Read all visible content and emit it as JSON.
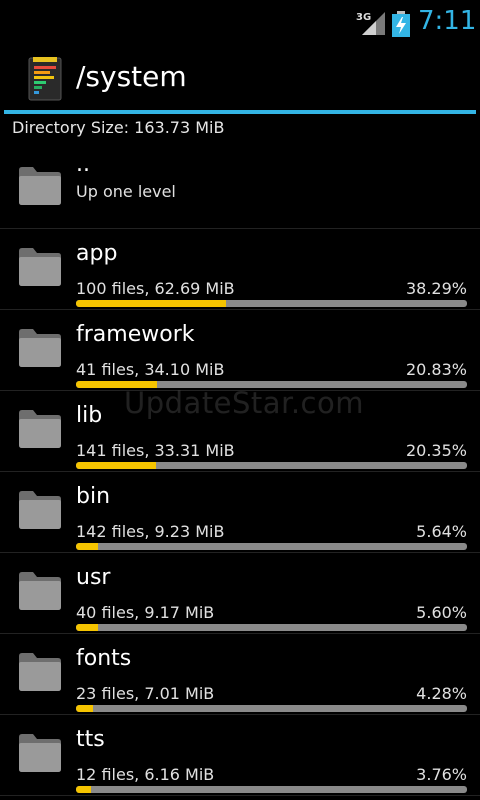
{
  "status_bar": {
    "network": "3G",
    "time": "7:11",
    "icons": [
      "signal-icon",
      "battery-charging-icon"
    ],
    "accent_color": "#33b5e5"
  },
  "action_bar": {
    "app_icon": "disk-usage-app-icon",
    "title": "/system"
  },
  "directory_size": "Directory Size: 163.73 MiB",
  "parent": {
    "name": "..",
    "subtitle": "Up one level"
  },
  "entries": [
    {
      "name": "app",
      "info": "100 files, 62.69 MiB",
      "percent": "38.29%",
      "fraction": 0.3829
    },
    {
      "name": "framework",
      "info": "41 files, 34.10 MiB",
      "percent": "20.83%",
      "fraction": 0.2083
    },
    {
      "name": "lib",
      "info": "141 files, 33.31 MiB",
      "percent": "20.35%",
      "fraction": 0.2035
    },
    {
      "name": "bin",
      "info": "142 files, 9.23 MiB",
      "percent": "5.64%",
      "fraction": 0.0564
    },
    {
      "name": "usr",
      "info": "40 files, 9.17 MiB",
      "percent": "5.60%",
      "fraction": 0.056
    },
    {
      "name": "fonts",
      "info": "23 files, 7.01 MiB",
      "percent": "4.28%",
      "fraction": 0.0428
    },
    {
      "name": "tts",
      "info": "12 files, 6.16 MiB",
      "percent": "3.76%",
      "fraction": 0.0376
    }
  ],
  "colors": {
    "bar_fill": "#f5c400",
    "bar_track": "#8a8a8a",
    "folder": "#8c8c8c"
  },
  "watermark": "UpdateStar.com"
}
